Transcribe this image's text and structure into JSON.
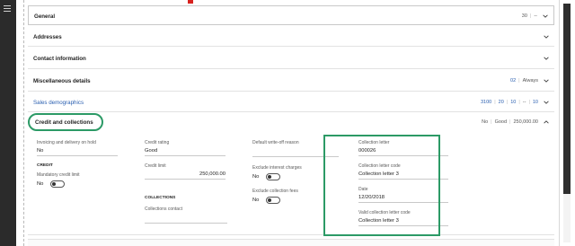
{
  "sections": {
    "general": {
      "title": "General",
      "summary": [
        "30",
        "--"
      ]
    },
    "addresses": {
      "title": "Addresses"
    },
    "contact": {
      "title": "Contact information"
    },
    "misc": {
      "title": "Miscellaneous details",
      "summary": [
        "02",
        "Always"
      ]
    },
    "sales": {
      "title": "Sales demographics",
      "summary": [
        "3100",
        "20",
        "10",
        "--",
        "10"
      ]
    },
    "credit": {
      "title": "Credit and collections",
      "summary": [
        "No",
        "Good",
        "250,000.00"
      ]
    }
  },
  "credit_fields": {
    "invoicing_hold_label": "Invoicing and delivery on hold",
    "invoicing_hold_value": "No",
    "credit_heading": "CREDIT",
    "mandatory_credit_limit_label": "Mandatory credit limit",
    "mandatory_credit_limit_value": "No",
    "credit_rating_label": "Credit rating",
    "credit_rating_value": "Good",
    "credit_limit_label": "Credit limit",
    "credit_limit_value": "250,000.00",
    "collections_heading": "COLLECTIONS",
    "collections_contact_label": "Collections contact",
    "collections_contact_value": "",
    "default_writeoff_label": "Default write-off reason",
    "default_writeoff_value": "",
    "exclude_interest_label": "Exclude interest charges",
    "exclude_interest_value": "No",
    "exclude_fees_label": "Exclude collection fees",
    "exclude_fees_value": "No",
    "collection_letter_label": "Collection letter",
    "collection_letter_value": "000026",
    "collection_letter_code_label": "Collection letter code",
    "collection_letter_code_value": "Collection letter 3",
    "date_label": "Date",
    "date_value": "12/20/2018",
    "valid_collection_letter_code_label": "Valid collection letter code",
    "valid_collection_letter_code_value": "Collection letter 3"
  },
  "colors": {
    "highlight": "#2c9a66",
    "link_blue": "#2a5fb0",
    "nav_dark": "#2b2b2b"
  },
  "icons": [
    "hamburger-icon",
    "chevron-down-icon",
    "chevron-up-icon"
  ]
}
